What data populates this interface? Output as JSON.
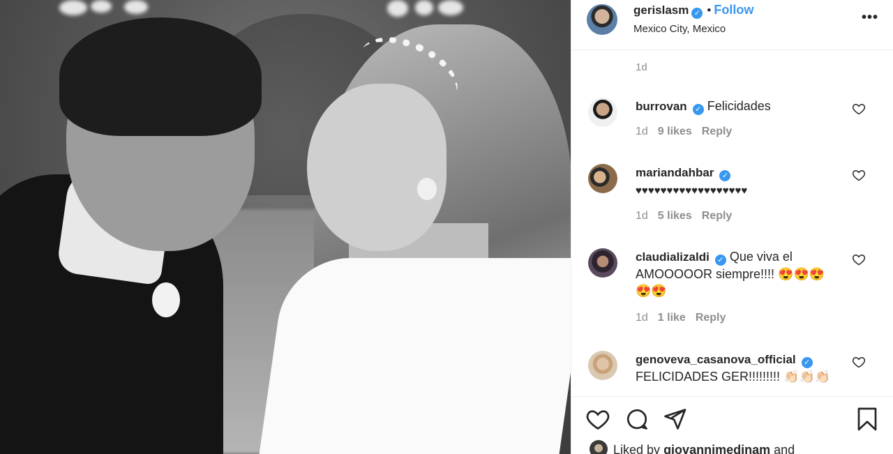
{
  "post": {
    "author": "gerislasm",
    "follow_label": "Follow",
    "separator": "•",
    "location": "Mexico City, Mexico",
    "time": "1d",
    "more_label": "•••"
  },
  "comments": [
    {
      "user": "burrovan",
      "verified": true,
      "text": "Felicidades",
      "time": "1d",
      "likes": "9 likes",
      "reply": "Reply"
    },
    {
      "user": "mariandahbar",
      "verified": true,
      "text": "♥♥♥♥♥♥♥♥♥♥♥♥♥♥♥♥♥♥",
      "time": "1d",
      "likes": "5 likes",
      "reply": "Reply"
    },
    {
      "user": "claudializaldi",
      "verified": true,
      "text": "Que viva el AMOOOOOR siempre!!!! 😍😍😍😍😍",
      "time": "1d",
      "likes": "1 like",
      "reply": "Reply"
    },
    {
      "user": "genoveva_casanova_official",
      "verified": true,
      "text": "FELICIDADES GER!!!!!!!!! 👏🏻👏🏻👏🏻",
      "time": "",
      "likes": "",
      "reply": ""
    }
  ],
  "likes_summary": {
    "prefix": "Liked by",
    "user": "giovannimedinam",
    "suffix": "and"
  },
  "icons": {
    "like": "heart-icon",
    "comment": "comment-icon",
    "share": "share-icon",
    "save": "bookmark-icon"
  },
  "colors": {
    "accent": "#3897f0",
    "muted": "#8e8e8e",
    "text": "#262626"
  }
}
